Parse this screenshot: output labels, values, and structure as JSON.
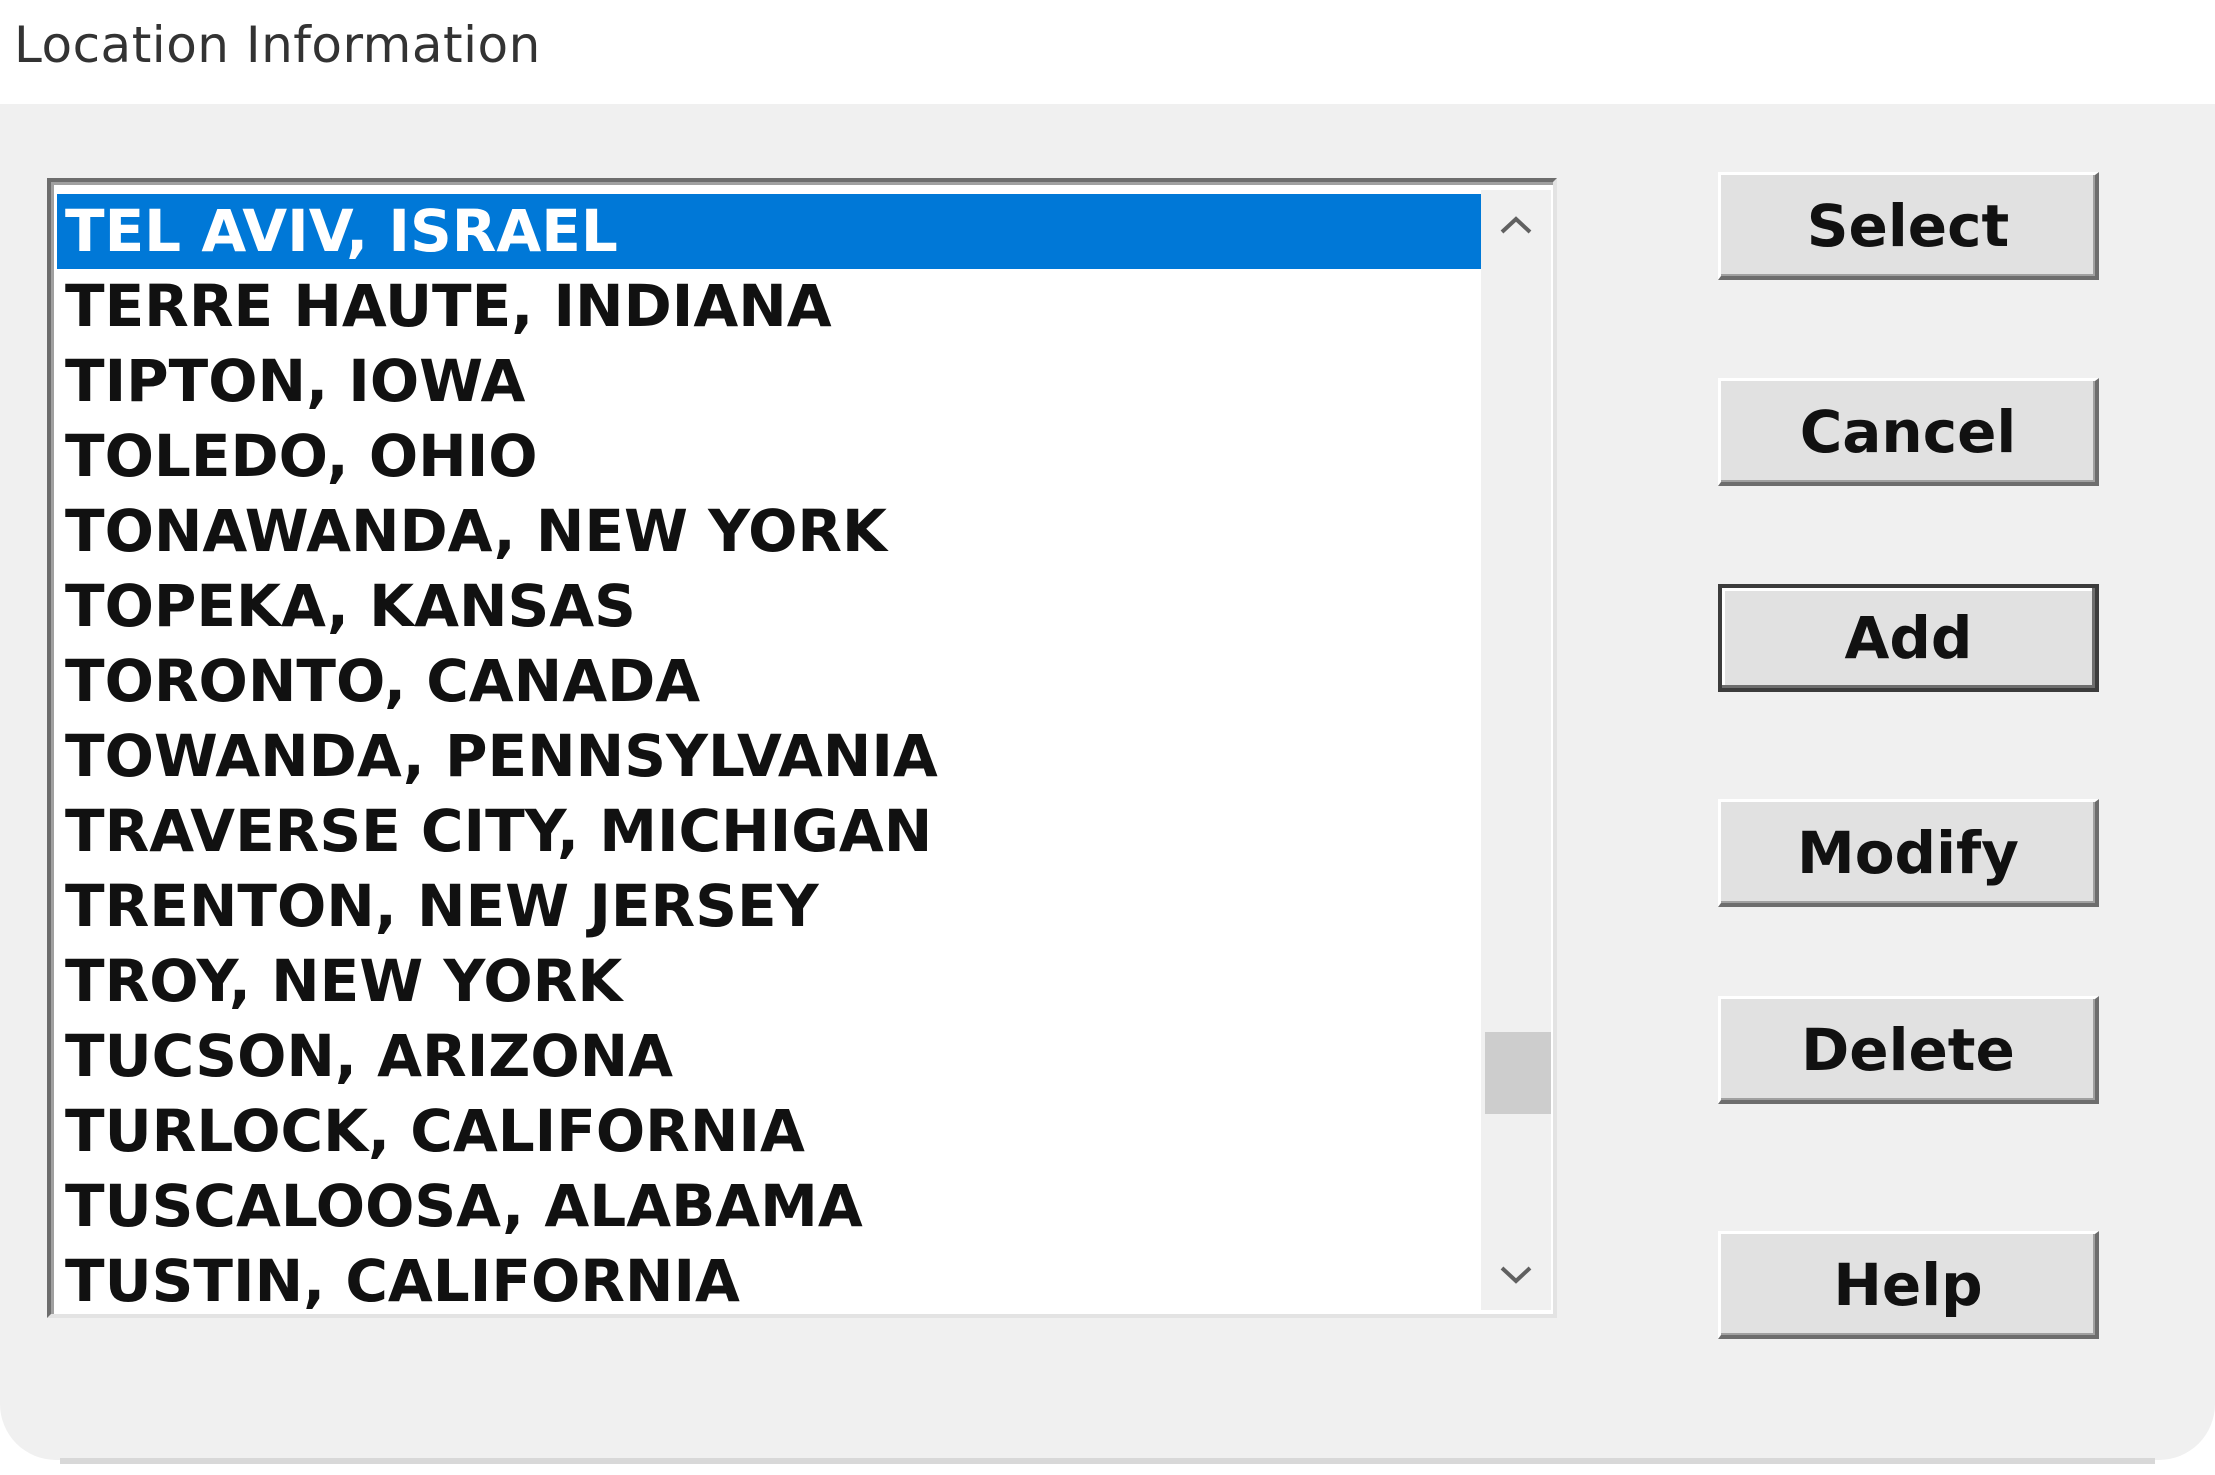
{
  "window": {
    "title": "Location Information"
  },
  "locations": {
    "selected_index": 0,
    "items": [
      "TEL AVIV, ISRAEL",
      "TERRE HAUTE, INDIANA",
      "TIPTON, IOWA",
      "TOLEDO, OHIO",
      "TONAWANDA, NEW YORK",
      "TOPEKA, KANSAS",
      "TORONTO, CANADA",
      "TOWANDA, PENNSYLVANIA",
      "TRAVERSE CITY, MICHIGAN",
      "TRENTON, NEW JERSEY",
      "TROY, NEW YORK",
      "TUCSON, ARIZONA",
      "TURLOCK, CALIFORNIA",
      "TUSCALOOSA, ALABAMA",
      "TUSTIN, CALIFORNIA"
    ]
  },
  "scrollbar": {
    "up_icon": "chevron-up-icon",
    "down_icon": "chevron-down-icon",
    "position_fraction": 0.86
  },
  "buttons": {
    "select": "Select",
    "cancel": "Cancel",
    "add": "Add",
    "modify": "Modify",
    "delete": "Delete",
    "help": "Help"
  },
  "colors": {
    "selection": "#0078d7",
    "dialog_bg": "#f0f0f0"
  }
}
